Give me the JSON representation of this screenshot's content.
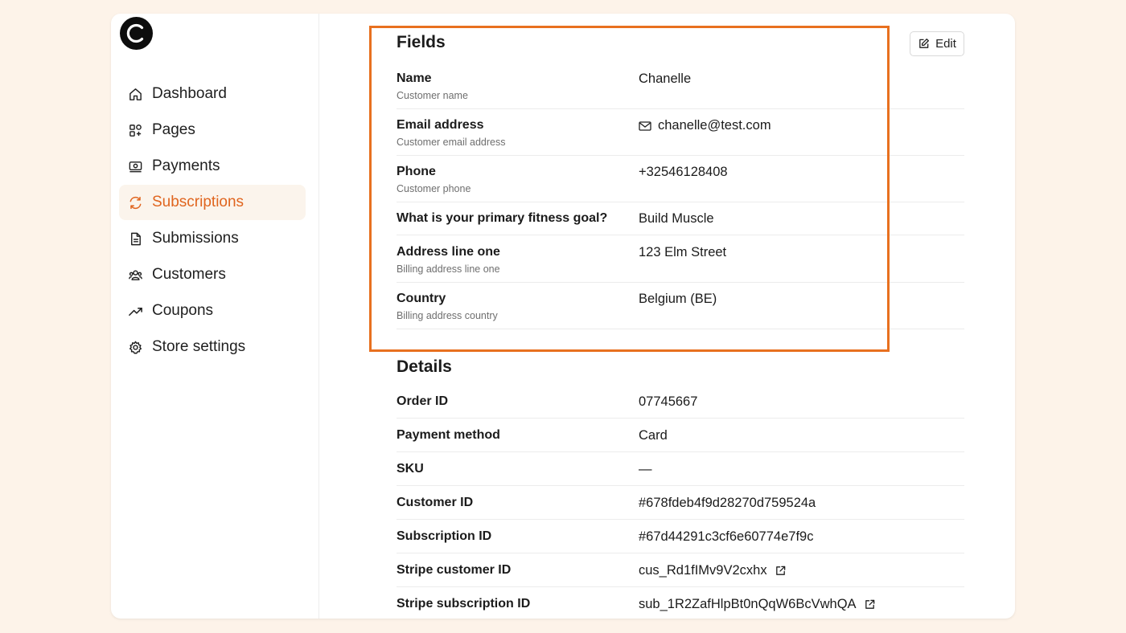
{
  "colors": {
    "accent": "#e0651f",
    "highlight": "#e8701f",
    "background": "#fdf3e9"
  },
  "sidebar": {
    "logo_icon": "brand-logo-icon",
    "items": [
      {
        "label": "Dashboard",
        "icon": "home-icon",
        "active": false
      },
      {
        "label": "Pages",
        "icon": "grid-plus-icon",
        "active": false
      },
      {
        "label": "Payments",
        "icon": "banknote-icon",
        "active": false
      },
      {
        "label": "Subscriptions",
        "icon": "refresh-icon",
        "active": true
      },
      {
        "label": "Submissions",
        "icon": "document-icon",
        "active": false
      },
      {
        "label": "Customers",
        "icon": "users-icon",
        "active": false
      },
      {
        "label": "Coupons",
        "icon": "trending-up-icon",
        "active": false
      },
      {
        "label": "Store settings",
        "icon": "gear-icon",
        "active": false
      }
    ]
  },
  "toolbar": {
    "edit_label": "Edit"
  },
  "fields": {
    "title": "Fields",
    "rows": [
      {
        "label": "Name",
        "sub": "Customer name",
        "value": "Chanelle"
      },
      {
        "label": "Email address",
        "sub": "Customer email address",
        "value": "chanelle@test.com"
      },
      {
        "label": "Phone",
        "sub": "Customer phone",
        "value": "+32546128408"
      },
      {
        "label": "What is your primary fitness goal?",
        "value": "Build Muscle"
      },
      {
        "label": "Address line one",
        "sub": "Billing address line one",
        "value": "123 Elm Street"
      },
      {
        "label": "Country",
        "sub": "Billing address country",
        "value": "Belgium (BE)"
      }
    ]
  },
  "details": {
    "title": "Details",
    "rows": [
      {
        "label": "Order ID",
        "value": "07745667"
      },
      {
        "label": "Payment method",
        "value": "Card"
      },
      {
        "label": "SKU",
        "value": "—"
      },
      {
        "label": "Customer ID",
        "value": "#678fdeb4f9d28270d759524a"
      },
      {
        "label": "Subscription ID",
        "value": "#67d44291c3cf6e60774e7f9c"
      },
      {
        "label": "Stripe customer ID",
        "value": "cus_Rd1fIMv9V2cxhx"
      },
      {
        "label": "Stripe subscription ID",
        "value": "sub_1R2ZafHlpBt0nQqW6BcVwhQA"
      }
    ]
  }
}
